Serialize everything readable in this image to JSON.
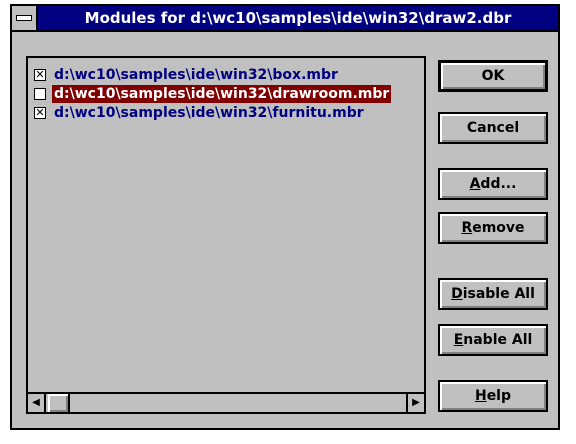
{
  "window": {
    "title": "Modules for d:\\wc10\\samples\\ide\\win32\\draw2.dbr"
  },
  "modules": [
    {
      "path": "d:\\wc10\\samples\\ide\\win32\\box.mbr",
      "checked": true,
      "selected": false
    },
    {
      "path": "d:\\wc10\\samples\\ide\\win32\\drawroom.mbr",
      "checked": false,
      "selected": true
    },
    {
      "path": "d:\\wc10\\samples\\ide\\win32\\furnitu.mbr",
      "checked": true,
      "selected": false
    }
  ],
  "buttons": {
    "ok": "OK",
    "cancel": "Cancel",
    "add_mnemonic": "A",
    "add_rest": "dd...",
    "remove_mnemonic": "R",
    "remove_rest": "emove",
    "disable_all_mnemonic": "D",
    "disable_all_rest": "isable All",
    "enable_all_mnemonic": "E",
    "enable_all_rest": "nable All",
    "help_mnemonic": "H",
    "help_rest": "elp"
  },
  "check_mark": "✕",
  "colors": {
    "title_bar": "#000080",
    "selection": "#800000",
    "item_text": "#000080",
    "face": "#c0c0c0"
  }
}
